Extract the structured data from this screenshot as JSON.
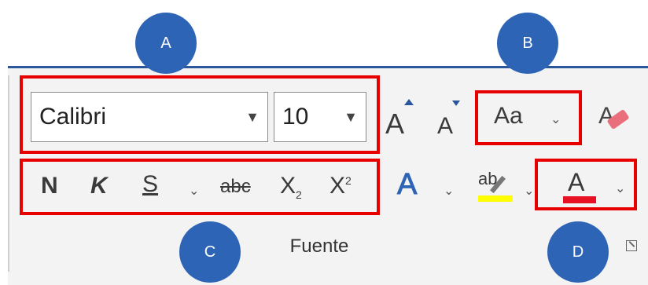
{
  "font_name": "Calibri",
  "font_size": "10",
  "grow_font_label": "A",
  "shrink_font_label": "A",
  "change_case_label": "Aa",
  "bold_label": "N",
  "italic_label": "K",
  "underline_label": "S",
  "strike_label": "abc",
  "subscript_label": "X",
  "subscript_small": "2",
  "superscript_label": "X",
  "superscript_small": "2",
  "text_effects_label": "A",
  "highlight_label": "ab",
  "font_color_label": "A",
  "group_label": "Fuente",
  "callouts": [
    "A",
    "B",
    "C",
    "D"
  ],
  "colors": {
    "accent_blue": "#2e64b5",
    "highlight_box": "#e60000",
    "font_color_bar": "#e81123",
    "highlight_bar": "#ffff00",
    "ribbon_bg": "#f3f3f3"
  }
}
